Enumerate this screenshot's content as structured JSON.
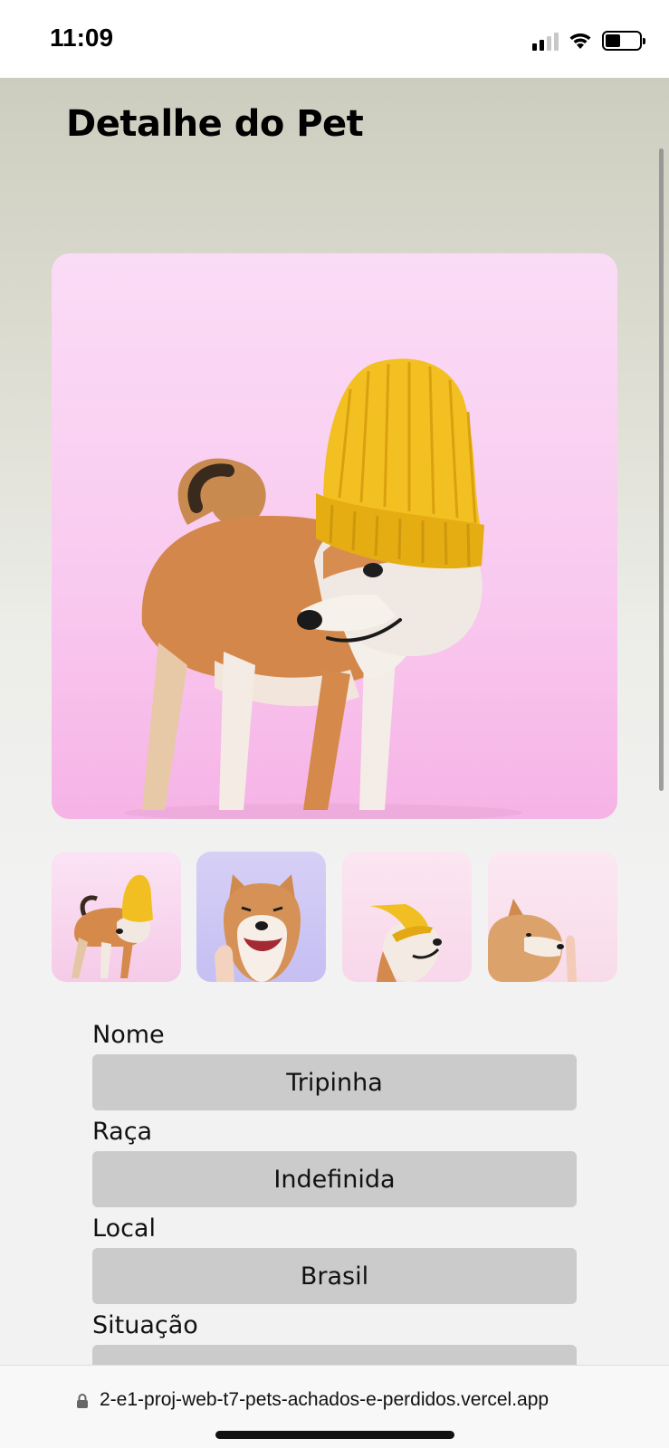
{
  "status_bar": {
    "time": "11:09",
    "battery_level": 0.45,
    "icons": [
      "signal-icon",
      "wifi-icon",
      "battery-icon"
    ]
  },
  "page": {
    "title": "Detalhe do Pet"
  },
  "gallery": {
    "main_image": "shiba-inu-dog-with-yellow-beanie-photo",
    "thumbnails": [
      "dog-with-beanie-thumbnail",
      "dog-smiling-thumbnail",
      "dog-with-hat-thumbnail",
      "dog-profile-thumbnail"
    ]
  },
  "details": {
    "fields": [
      {
        "label": "Nome",
        "value": "Tripinha"
      },
      {
        "label": "Raça",
        "value": "Indefinida"
      },
      {
        "label": "Local",
        "value": "Brasil"
      },
      {
        "label": "Situação",
        "value": ""
      }
    ]
  },
  "browser": {
    "url": "2-e1-proj-web-t7-pets-achados-e-perdidos.vercel.app"
  },
  "colors": {
    "field_background": "#cbcbcb",
    "header_gradient_top": "#cdcdbf",
    "page_background": "#f2f2f2"
  }
}
